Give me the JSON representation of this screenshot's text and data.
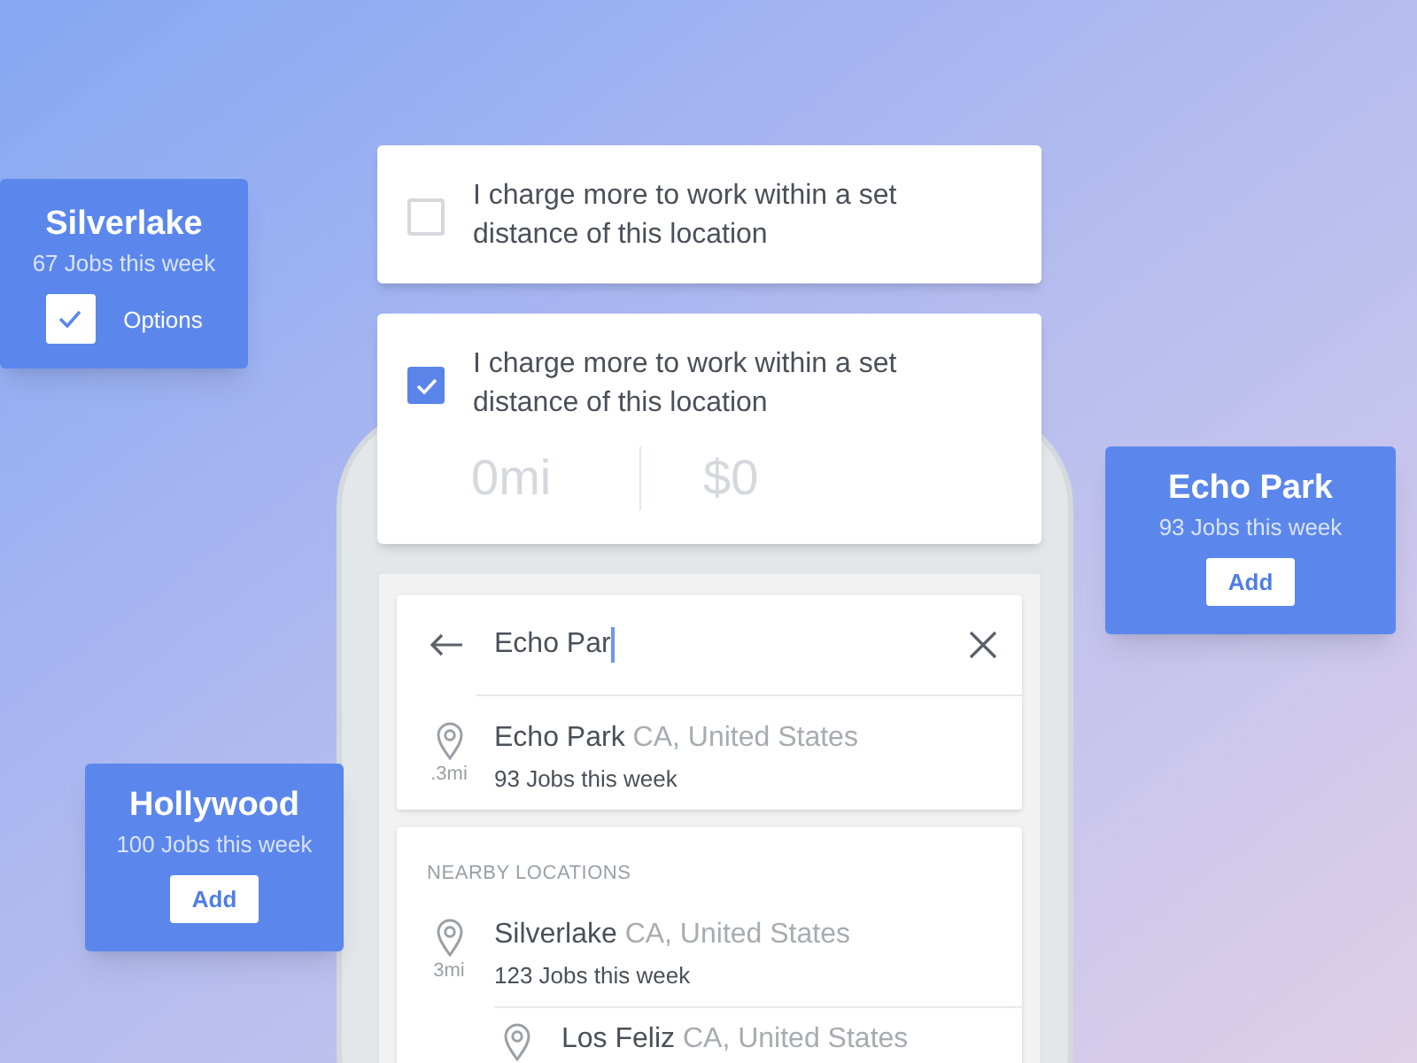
{
  "location_cards": [
    {
      "kind": "options",
      "name": "Silverlake",
      "jobs": "67 Jobs this week",
      "checked": true,
      "button": "Options"
    },
    {
      "kind": "add",
      "name": "Echo Park",
      "jobs": "93 Jobs this week",
      "button": "Add"
    },
    {
      "kind": "add",
      "name": "Hollywood",
      "jobs": "100 Jobs this week",
      "button": "Add"
    }
  ],
  "settings": [
    {
      "label": "I charge more to work within a set distance of this location",
      "checked": false
    },
    {
      "label": "I charge more to work within a set distance of this location",
      "checked": true,
      "distance": "0",
      "unit": "mi",
      "price": "$0"
    }
  ],
  "search": {
    "value": "Echo Par",
    "result": {
      "name": "Echo Park",
      "region": "CA, United States",
      "distance": ".3mi",
      "jobs": "93 Jobs this week"
    }
  },
  "nearby": {
    "heading": "NEARBY LOCATIONS",
    "items": [
      {
        "name": "Silverlake",
        "region": "CA, United States",
        "distance": "3mi",
        "jobs": "123 Jobs this week"
      },
      {
        "name": "Los Feliz",
        "region": "CA, United States"
      }
    ]
  }
}
